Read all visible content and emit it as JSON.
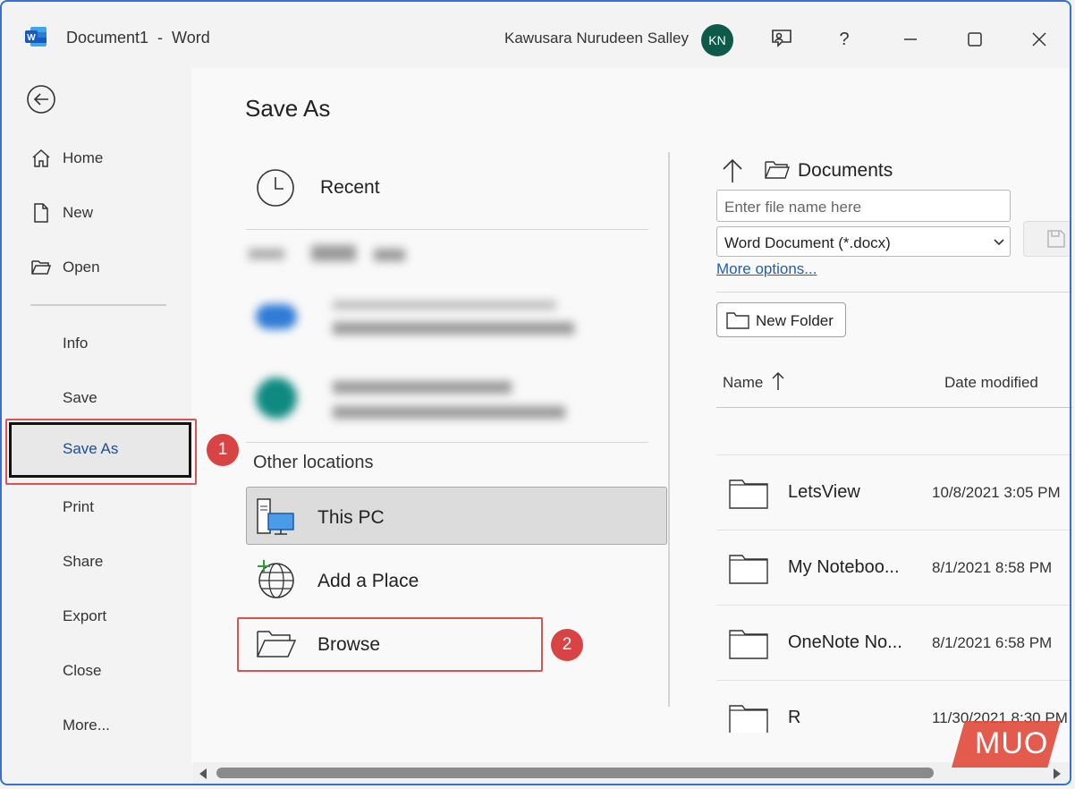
{
  "window": {
    "title": "Document1  -  Word",
    "user_name": "Kawusara Nurudeen Salley",
    "avatar_initials": "KN",
    "help_label": "?",
    "accent": "#3a6fd6"
  },
  "sidebar": {
    "items": [
      {
        "label": "Home",
        "icon": "home-icon"
      },
      {
        "label": "New",
        "icon": "new-document-icon"
      },
      {
        "label": "Open",
        "icon": "open-folder-icon"
      },
      {
        "label": "Info"
      },
      {
        "label": "Save"
      },
      {
        "label": "Save As",
        "selected": true
      },
      {
        "label": "Print"
      },
      {
        "label": "Share"
      },
      {
        "label": "Export"
      },
      {
        "label": "Close"
      },
      {
        "label": "More..."
      }
    ]
  },
  "annotations": {
    "step1": "1",
    "step2": "2",
    "color": "#d84343"
  },
  "main": {
    "title": "Save As",
    "recent_label": "Recent",
    "other_locations_label": "Other locations",
    "locations": [
      {
        "label": "This PC",
        "icon": "this-pc-icon",
        "selected": true
      },
      {
        "label": "Add a Place",
        "icon": "globe-add-icon"
      },
      {
        "label": "Browse",
        "icon": "browse-folder-icon"
      }
    ]
  },
  "right_pane": {
    "current_folder": "Documents",
    "filename_placeholder": "Enter file name here",
    "file_type": "Word Document (*.docx)",
    "more_options": "More options...",
    "new_folder": "New Folder",
    "columns": {
      "name": "Name",
      "date_modified": "Date modified"
    },
    "files": [
      {
        "name": "LetsView",
        "date": "10/8/2021 3:05 PM"
      },
      {
        "name": "My Noteboo...",
        "date": "8/1/2021 8:58 PM"
      },
      {
        "name": "OneNote No...",
        "date": "8/1/2021 6:58 PM"
      },
      {
        "name": "R",
        "date": "11/30/2021 8:30 PM"
      }
    ]
  },
  "watermark": "MUO"
}
